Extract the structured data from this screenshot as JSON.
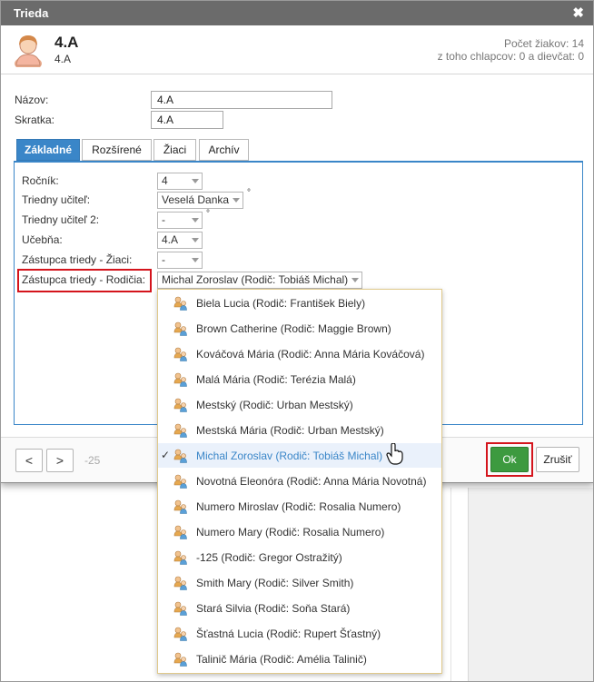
{
  "window": {
    "title": "Trieda",
    "close_symbol": "✖"
  },
  "header": {
    "class_name": "4.A",
    "class_subtitle": "4.A",
    "students_count_text": "Počet žiakov: 14",
    "gender_breakdown_text": "z toho chlapcov: 0 a dievčat: 0"
  },
  "form": {
    "name_label": "Názov:",
    "name_value": "4.A",
    "short_label": "Skratka:",
    "short_value": "4.A"
  },
  "tabs": [
    {
      "label": "Základné",
      "active": true
    },
    {
      "label": "Rozšírené",
      "active": false
    },
    {
      "label": "Žiaci",
      "active": false
    },
    {
      "label": "Archív",
      "active": false
    }
  ],
  "fields": {
    "grade_label": "Ročník:",
    "grade_value": "4",
    "teacher_label": "Triedny učiteľ:",
    "teacher_value": "Veselá Danka",
    "teacher2_label": "Triedny učiteľ 2:",
    "teacher2_value": "-",
    "room_label": "Učebňa:",
    "room_value": "4.A",
    "student_rep_label": "Zástupca triedy - Žiaci:",
    "student_rep_value": "-",
    "parent_rep_label": "Zástupca triedy - Rodičia:",
    "parent_rep_value": "Michal Zoroslav (Rodič: Tobiáš Michal)",
    "degree_symbol": "°"
  },
  "footer": {
    "prev_label": "<",
    "next_label": ">",
    "counter_text": "-25",
    "ok_label": "Ok",
    "cancel_label": "Zrušiť"
  },
  "dropdown": {
    "options": [
      {
        "label": "Biela Lucia (Rodič: František Biely)"
      },
      {
        "label": "Brown Catherine (Rodič: Maggie Brown)"
      },
      {
        "label": "Kováčová Mária (Rodič: Anna Mária Kováčová)"
      },
      {
        "label": "Malá Mária (Rodič: Terézia Malá)"
      },
      {
        "label": "Mestský (Rodič: Urban Mestský)"
      },
      {
        "label": "Mestská Mária (Rodič: Urban Mestský)"
      },
      {
        "label": "Michal Zoroslav (Rodič: Tobiáš Michal)",
        "selected": true
      },
      {
        "label": "Novotná Eleonóra (Rodič: Anna Mária Novotná)"
      },
      {
        "label": "Numero Miroslav (Rodič: Rosalia Numero)"
      },
      {
        "label": "Numero Mary (Rodič: Rosalia Numero)"
      },
      {
        "label": "-125 (Rodič: Gregor Ostražitý)"
      },
      {
        "label": "Smith Mary (Rodič: Silver Smith)"
      },
      {
        "label": "Stará Silvia (Rodič: Soňa Stará)"
      },
      {
        "label": "Šťastná Lucia (Rodič: Rupert Šťastný)"
      },
      {
        "label": "Talinič Mária (Rodič: Amélia Talinič)"
      }
    ],
    "check_symbol": "✓"
  },
  "colors": {
    "accent": "#3a86c8",
    "ok_button": "#3d9a3f",
    "highlight": "#d4141c",
    "titlebar": "#6b6b6b"
  },
  "icons": {
    "header_avatar": "student-avatar-icon",
    "option_icon": "parent-child-icon",
    "close": "close-icon",
    "cursor": "hand-pointer-icon"
  }
}
